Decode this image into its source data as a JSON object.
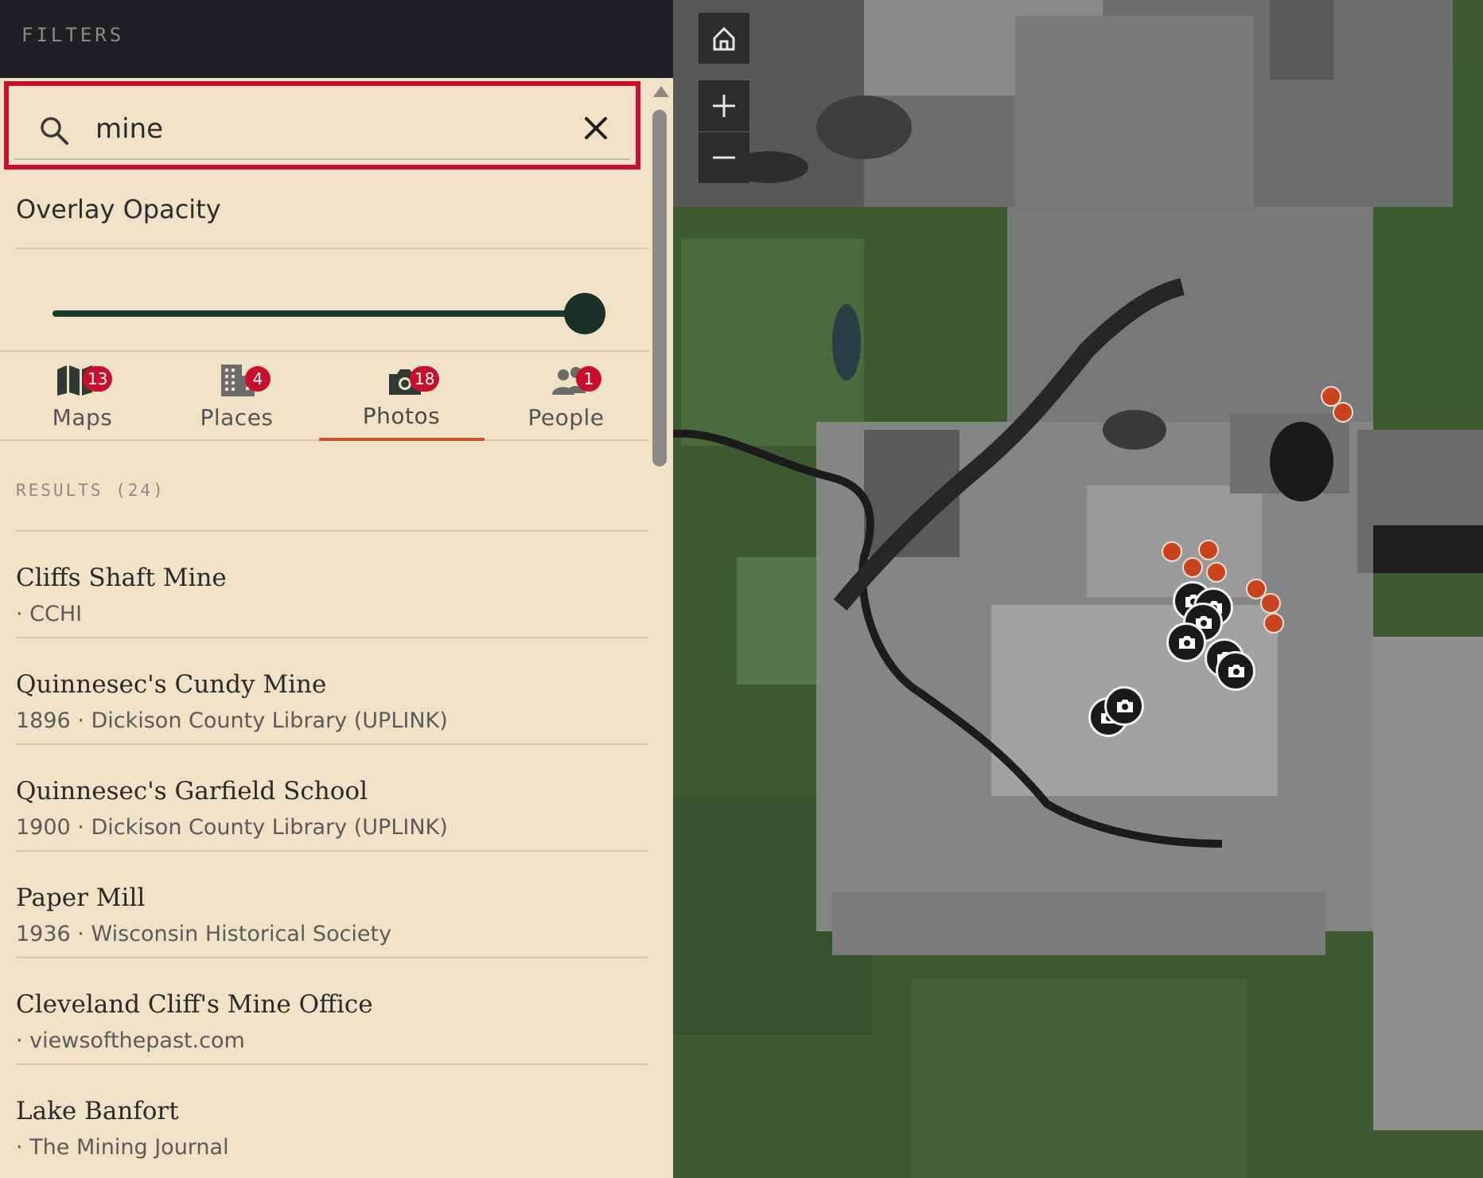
{
  "filters": {
    "title": "FILTERS"
  },
  "search": {
    "value": "mine",
    "placeholder": ""
  },
  "overlay": {
    "label": "Overlay Opacity",
    "value_fraction": 1.0
  },
  "tabs": [
    {
      "label": "Maps",
      "count": "13",
      "icon": "map-icon"
    },
    {
      "label": "Places",
      "count": "4",
      "icon": "building-icon"
    },
    {
      "label": "Photos",
      "count": "18",
      "icon": "camera-icon"
    },
    {
      "label": "People",
      "count": "1",
      "icon": "people-icon"
    }
  ],
  "active_tab": "Photos",
  "results": {
    "header": "RESULTS (24)",
    "items": [
      {
        "title": "Cliffs Shaft Mine",
        "meta": "· CCHI"
      },
      {
        "title": "Quinnesec's Cundy Mine",
        "meta": "1896 · Dickison County Library (UPLINK)"
      },
      {
        "title": "Quinnesec's Garfield School",
        "meta": "1900 · Dickison County Library (UPLINK)"
      },
      {
        "title": "Paper Mill",
        "meta": "1936 · Wisconsin Historical Society"
      },
      {
        "title": "Cleveland Cliff's Mine Office",
        "meta": "· viewsofthepast.com"
      },
      {
        "title": "Lake Banfort",
        "meta": "· The Mining Journal"
      }
    ]
  },
  "map": {
    "controls": [
      "home-icon",
      "zoom-in-icon",
      "zoom-out-icon"
    ],
    "colors": {
      "accent": "#c8102e",
      "place_marker": "#c8431e",
      "photo_marker": "#1a1a1a",
      "tab_underline": "#c8502e"
    }
  }
}
